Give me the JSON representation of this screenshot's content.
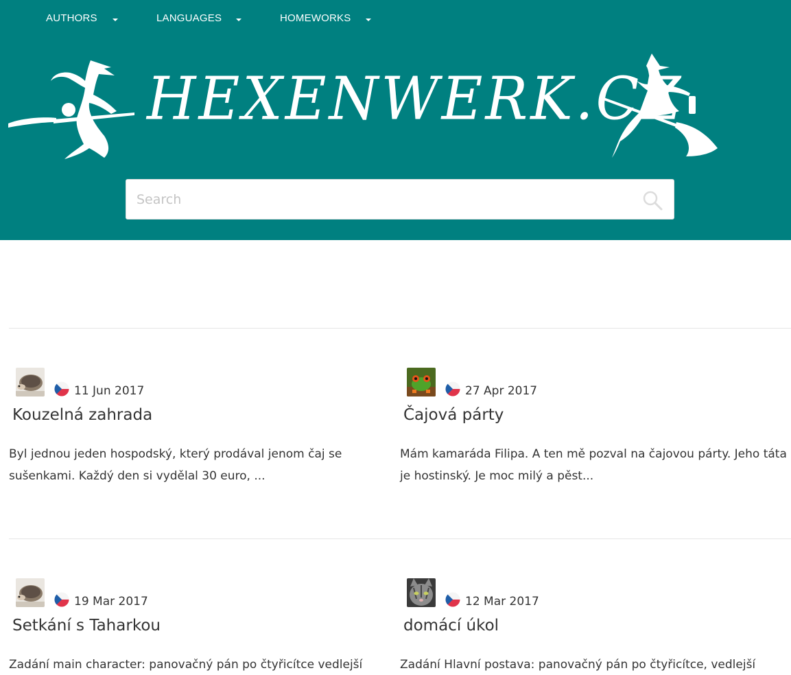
{
  "nav": {
    "items": [
      {
        "label": "AUTHORS"
      },
      {
        "label": "LANGUAGES"
      },
      {
        "label": "HOMEWORKS"
      }
    ]
  },
  "site": {
    "title": "HEXENWERK.CZ",
    "brand_color": "#008080"
  },
  "search": {
    "placeholder": "Search",
    "value": ""
  },
  "posts": [
    {
      "avatar": "hedgehog-avatar",
      "flag": "czech-flag-icon",
      "date": "11 Jun 2017",
      "title": "Kouzelná zahrada",
      "excerpt": "Byl jednou jeden hospodský, který prodával jenom čaj se sušenkami. Každý den si vydělal 30 euro, ..."
    },
    {
      "avatar": "frog-avatar",
      "flag": "czech-flag-icon",
      "date": "27 Apr 2017",
      "title": "Čajová párty",
      "excerpt": "Mám kamaráda Filipa. A ten mě pozval na čajovou párty. Jeho táta je hostinský. Je moc milý a pěst..."
    },
    {
      "avatar": "hedgehog-avatar",
      "flag": "czech-flag-icon",
      "date": "19 Mar 2017",
      "title": "Setkání s Taharkou",
      "excerpt": "Zadání main character: panovačný pán po čtyřicítce vedlejší"
    },
    {
      "avatar": "cat-avatar",
      "flag": "czech-flag-icon",
      "date": "12 Mar 2017",
      "title": "domácí úkol",
      "excerpt": "Zadání Hlavní postava: panovačný pán po čtyřicítce, vedlejší"
    }
  ]
}
